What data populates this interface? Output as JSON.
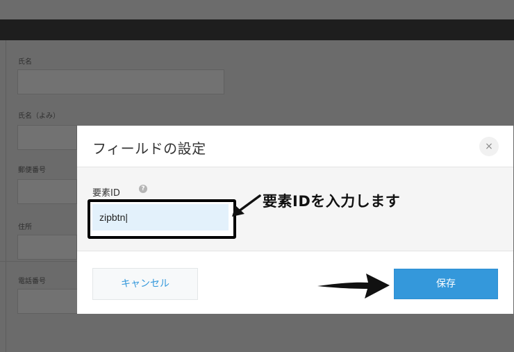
{
  "background_form": {
    "labels": [
      "氏名",
      "氏名（よみ）",
      "郵便番号",
      "住所",
      "電話番号"
    ]
  },
  "dialog": {
    "title": "フィールドの設定",
    "close_icon": "×",
    "field_label": "要素ID",
    "help_icon": "?",
    "element_id_value": "zipbtn|",
    "cancel_label": "キャンセル",
    "save_label": "保存"
  },
  "annotation": {
    "text": "要素IDを入力します"
  },
  "colors": {
    "accent": "#3498db",
    "input_bg": "#e3f1fb",
    "header_bar": "#1e1e1e"
  }
}
